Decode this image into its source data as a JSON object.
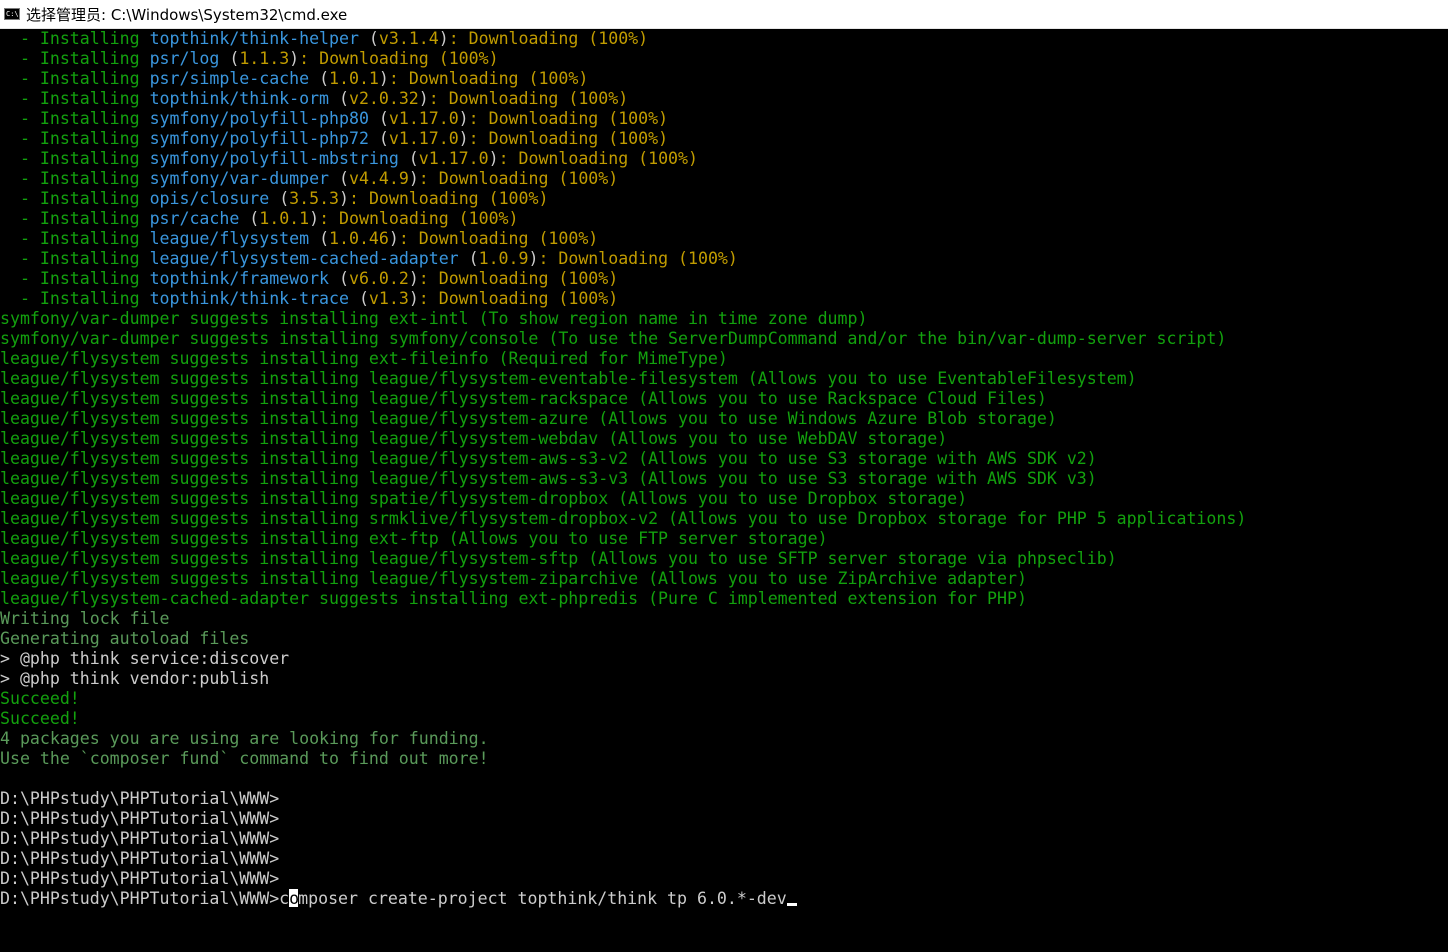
{
  "window": {
    "title": "选择管理员: C:\\Windows\\System32\\cmd.exe",
    "icon": "C:\\",
    "icon_name": "cmd-icon"
  },
  "installs": [
    {
      "pkg": "topthink/think-helper",
      "ver": "v3.1.4"
    },
    {
      "pkg": "psr/log",
      "ver": "1.1.3"
    },
    {
      "pkg": "psr/simple-cache",
      "ver": "1.0.1"
    },
    {
      "pkg": "topthink/think-orm",
      "ver": "v2.0.32"
    },
    {
      "pkg": "symfony/polyfill-php80",
      "ver": "v1.17.0"
    },
    {
      "pkg": "symfony/polyfill-php72",
      "ver": "v1.17.0"
    },
    {
      "pkg": "symfony/polyfill-mbstring",
      "ver": "v1.17.0"
    },
    {
      "pkg": "symfony/var-dumper",
      "ver": "v4.4.9"
    },
    {
      "pkg": "opis/closure",
      "ver": "3.5.3"
    },
    {
      "pkg": "psr/cache",
      "ver": "1.0.1"
    },
    {
      "pkg": "league/flysystem",
      "ver": "1.0.46"
    },
    {
      "pkg": "league/flysystem-cached-adapter",
      "ver": "1.0.9"
    },
    {
      "pkg": "topthink/framework",
      "ver": "v6.0.2"
    },
    {
      "pkg": "topthink/think-trace",
      "ver": "v1.3"
    }
  ],
  "install_prefix": "  - Installing ",
  "install_suffix": ": Downloading (100%)",
  "suggests": [
    "symfony/var-dumper suggests installing ext-intl (To show region name in time zone dump)",
    "symfony/var-dumper suggests installing symfony/console (To use the ServerDumpCommand and/or the bin/var-dump-server script)",
    "league/flysystem suggests installing ext-fileinfo (Required for MimeType)",
    "league/flysystem suggests installing league/flysystem-eventable-filesystem (Allows you to use EventableFilesystem)",
    "league/flysystem suggests installing league/flysystem-rackspace (Allows you to use Rackspace Cloud Files)",
    "league/flysystem suggests installing league/flysystem-azure (Allows you to use Windows Azure Blob storage)",
    "league/flysystem suggests installing league/flysystem-webdav (Allows you to use WebDAV storage)",
    "league/flysystem suggests installing league/flysystem-aws-s3-v2 (Allows you to use S3 storage with AWS SDK v2)",
    "league/flysystem suggests installing league/flysystem-aws-s3-v3 (Allows you to use S3 storage with AWS SDK v3)",
    "league/flysystem suggests installing spatie/flysystem-dropbox (Allows you to use Dropbox storage)",
    "league/flysystem suggests installing srmklive/flysystem-dropbox-v2 (Allows you to use Dropbox storage for PHP 5 applications)",
    "league/flysystem suggests installing ext-ftp (Allows you to use FTP server storage)",
    "league/flysystem suggests installing league/flysystem-sftp (Allows you to use SFTP server storage via phpseclib)",
    "league/flysystem suggests installing league/flysystem-ziparchive (Allows you to use ZipArchive adapter)",
    "league/flysystem-cached-adapter suggests installing ext-phpredis (Pure C implemented extension for PHP)"
  ],
  "status": {
    "writing_lock": "Writing lock file",
    "generating": "Generating autoload files",
    "script1": "> @php think service:discover",
    "script2": "> @php think vendor:publish",
    "succeed1": "Succeed!",
    "succeed2": "Succeed!",
    "funding1": "4 packages you are using are looking for funding.",
    "funding2": "Use the `composer fund` command to find out more!"
  },
  "prompts": [
    "D:\\PHPstudy\\PHPTutorial\\WWW>",
    "D:\\PHPstudy\\PHPTutorial\\WWW>",
    "D:\\PHPstudy\\PHPTutorial\\WWW>",
    "D:\\PHPstudy\\PHPTutorial\\WWW>",
    "D:\\PHPstudy\\PHPTutorial\\WWW>"
  ],
  "command": {
    "prompt": "D:\\PHPstudy\\PHPTutorial\\WWW>",
    "first_char_before": "c",
    "cursor_char": "o",
    "rest": "mposer create-project topthink/think tp 6.0.*-dev"
  },
  "colors": {
    "background": "#000000",
    "green": "#13a10e",
    "cyan": "#3a96dd",
    "orange": "#c19c00",
    "gray": "#cccccc"
  }
}
